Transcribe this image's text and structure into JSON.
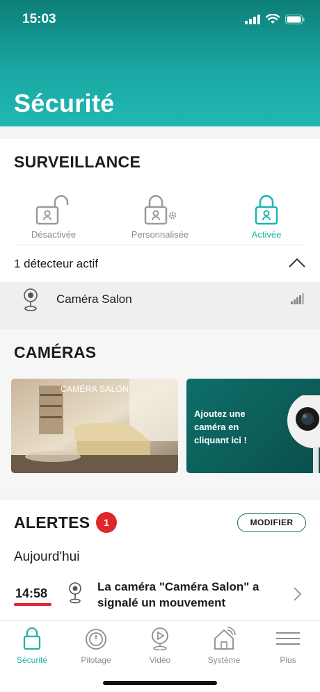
{
  "status_bar": {
    "time": "15:03"
  },
  "header": {
    "title": "Sécurité"
  },
  "surveillance": {
    "title": "SURVEILLANCE",
    "modes": [
      {
        "label": "Désactivée",
        "active": false
      },
      {
        "label": "Personnalisée",
        "active": false
      },
      {
        "label": "Activée",
        "active": true
      }
    ],
    "detector_summary": "1 détecteur actif",
    "detectors": [
      {
        "name": "Caméra Salon"
      }
    ]
  },
  "cameras": {
    "title": "CAMÉRAS",
    "items": [
      {
        "name": "CAMÉRA SALON"
      }
    ],
    "add_camera_text": "Ajoutez une caméra en cliquant ici !"
  },
  "alerts": {
    "title": "ALERTES",
    "count": "1",
    "modify_label": "MODIFIER",
    "day_label": "Aujourd'hui",
    "items": [
      {
        "time": "14:58",
        "message": "La caméra \"Caméra Salon\" a signalé un mouvement"
      }
    ]
  },
  "tabbar": {
    "items": [
      {
        "label": "Sécurité"
      },
      {
        "label": "Pilotage"
      },
      {
        "label": "Vidéo"
      },
      {
        "label": "Système"
      },
      {
        "label": "Plus"
      }
    ]
  },
  "colors": {
    "accent": "#1fb3ad",
    "alert_red": "#e0262b",
    "header_dark": "#0d7f78",
    "header_light": "#22b7b3"
  }
}
